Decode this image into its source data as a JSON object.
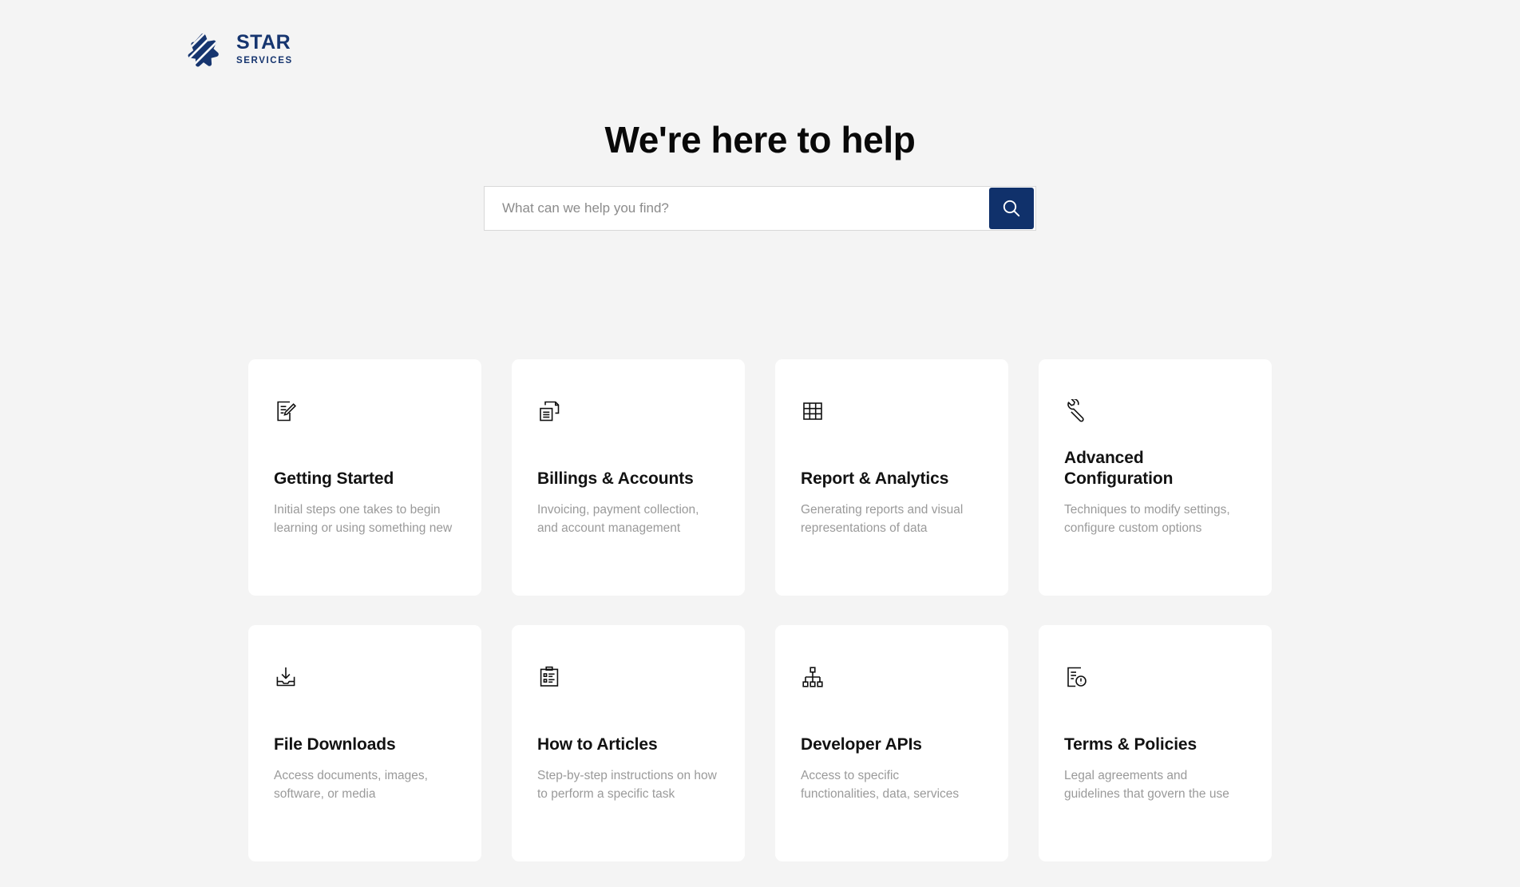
{
  "brand": {
    "name": "STAR",
    "tagline": "SERVICES",
    "logo_icon": "star-stripes-logo-icon",
    "color": "#16356f"
  },
  "hero": {
    "title": "We're here to help"
  },
  "search": {
    "placeholder": "What can we help you find?",
    "value": "",
    "button_icon": "search-icon",
    "button_color": "#10316b"
  },
  "cards": [
    {
      "icon": "document-edit-icon",
      "title": "Getting Started",
      "description": "Initial steps one takes to begin learning or using something new"
    },
    {
      "icon": "copy-documents-icon",
      "title": "Billings & Accounts",
      "description": "Invoicing, payment collection, and account management"
    },
    {
      "icon": "grid-table-icon",
      "title": "Report & Analytics",
      "description": "Generating reports and visual representations of data"
    },
    {
      "icon": "wrench-icon",
      "title": "Advanced Configuration",
      "description": "Techniques to modify settings, configure custom options"
    },
    {
      "icon": "download-tray-icon",
      "title": "File Downloads",
      "description": "Access documents, images, software, or media"
    },
    {
      "icon": "clipboard-list-icon",
      "title": "How to Articles",
      "description": "Step-by-step instructions on how to perform a specific task"
    },
    {
      "icon": "hierarchy-icon",
      "title": "Developer APIs",
      "description": "Access to specific functionalities, data, services"
    },
    {
      "icon": "document-alert-icon",
      "title": "Terms & Policies",
      "description": "Legal agreements and guidelines that govern the use"
    }
  ],
  "theme": {
    "page_background": "#f4f4f4",
    "card_background": "#ffffff",
    "title_color": "#121212",
    "description_color": "#9a9a9a"
  }
}
